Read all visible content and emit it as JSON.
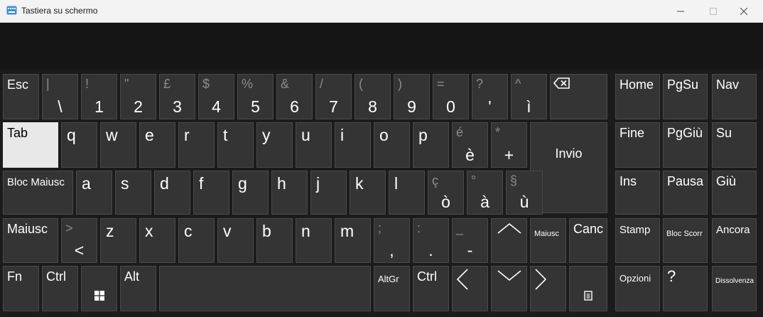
{
  "window": {
    "title": "Tastiera su schermo"
  },
  "keys": {
    "esc": "Esc",
    "n1": {
      "shift": "!",
      "main": "1"
    },
    "n2": {
      "shift": "\"",
      "main": "2"
    },
    "n3": {
      "shift": "£",
      "main": "3"
    },
    "n4": {
      "shift": "$",
      "main": "4"
    },
    "n5": {
      "shift": "%",
      "main": "5"
    },
    "n6": {
      "shift": "&",
      "main": "6"
    },
    "n7": {
      "shift": "/",
      "main": "7"
    },
    "n8": {
      "shift": "(",
      "main": "8"
    },
    "n9": {
      "shift": ")",
      "main": "9"
    },
    "n0": {
      "shift": "=",
      "main": "0"
    },
    "apos": {
      "shift": "?",
      "main": "'"
    },
    "igrave": {
      "shift": "^",
      "main": "ì"
    },
    "backslash": {
      "shift": "|",
      "main": "\\"
    },
    "tab": "Tab",
    "q": "q",
    "w": "w",
    "e": "e",
    "r": "r",
    "t": "t",
    "y": "y",
    "u": "u",
    "i": "i",
    "o": "o",
    "p": "p",
    "egrave": {
      "shift": "é",
      "main": "è"
    },
    "plus": {
      "shift": "*",
      "main": "+"
    },
    "invio": "Invio",
    "caps": "Bloc Maiusc",
    "a": "a",
    "s": "s",
    "d": "d",
    "f": "f",
    "g": "g",
    "h": "h",
    "j": "j",
    "k": "k",
    "l": "l",
    "ograve": {
      "shift": "ç",
      "main": "ò"
    },
    "agrave": {
      "shift": "°",
      "main": "à"
    },
    "ugrave": {
      "shift": "§",
      "main": "ù"
    },
    "lshift": "Maiusc",
    "lt": {
      "shift": ">",
      "main": "<"
    },
    "z": "z",
    "x": "x",
    "c": "c",
    "v": "v",
    "b": "b",
    "n": "n",
    "m": "m",
    "comma": {
      "shift": ";",
      "main": ","
    },
    "period": {
      "shift": ":",
      "main": "."
    },
    "minus": {
      "shift": "_",
      "main": "-"
    },
    "rshift": "Maiusc",
    "canc": "Canc",
    "fn": "Fn",
    "ctrl": "Ctrl",
    "alt": "Alt",
    "altgr": "AltGr",
    "rctrl": "Ctrl",
    "home": "Home",
    "pgsu": "PgSu",
    "nav": "Nav",
    "fine": "Fine",
    "pggiu": "PgGiù",
    "su": "Su",
    "ins": "Ins",
    "pausa": "Pausa",
    "giu": "Giù",
    "stamp": "Stamp",
    "blocscorr": "Bloc Scorr",
    "ancora": "Ancora",
    "opzioni": "Opzioni",
    "help": "?",
    "dissolvenza": "Dissolvenza"
  },
  "icons": {
    "app": "keyboard-icon",
    "backspace": "backspace-icon",
    "windows": "windows-logo-icon",
    "menu": "context-menu-icon",
    "up": "chevron-up-icon",
    "down": "chevron-down-icon",
    "left": "chevron-left-icon",
    "right": "chevron-right-icon"
  },
  "colors": {
    "key": "#343434",
    "key_active": "#e8e8e8",
    "background": "#1b1b1b",
    "titlebar": "#f3f3f3"
  }
}
